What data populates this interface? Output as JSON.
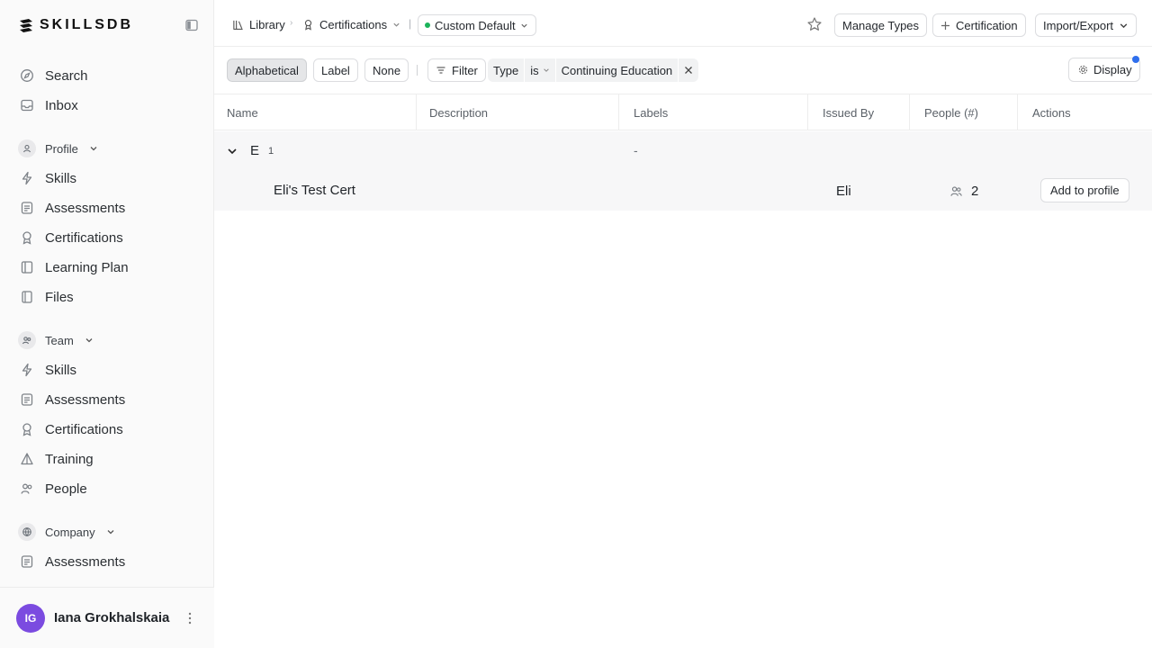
{
  "brand": {
    "name": "SKILLSDB"
  },
  "sidebar": {
    "top_items": [
      {
        "label": "Search",
        "icon": "compass-icon"
      },
      {
        "label": "Inbox",
        "icon": "inbox-icon"
      }
    ],
    "profile": {
      "label": "Profile",
      "items": [
        {
          "label": "Skills",
          "icon": "bolt-icon"
        },
        {
          "label": "Assessments",
          "icon": "clipboard-icon"
        },
        {
          "label": "Certifications",
          "icon": "award-icon"
        },
        {
          "label": "Learning Plan",
          "icon": "book-icon"
        },
        {
          "label": "Files",
          "icon": "file-icon"
        }
      ]
    },
    "team": {
      "label": "Team",
      "items": [
        {
          "label": "Skills",
          "icon": "bolt-icon"
        },
        {
          "label": "Assessments",
          "icon": "clipboard-icon"
        },
        {
          "label": "Certifications",
          "icon": "award-icon"
        },
        {
          "label": "Training",
          "icon": "training-icon"
        },
        {
          "label": "People",
          "icon": "people-icon"
        }
      ]
    },
    "company": {
      "label": "Company",
      "items": [
        {
          "label": "Assessments",
          "icon": "clipboard-icon"
        }
      ]
    },
    "user": {
      "initials": "IG",
      "name": "Iana Grokhalskaia",
      "avatar_color": "#7b4be0"
    }
  },
  "topbar": {
    "breadcrumb_library": "Library",
    "breadcrumb_certifications": "Certifications",
    "view_name": "Custom Default",
    "view_dot_color": "#1bb35a",
    "manage_types": "Manage Types",
    "add_certification": "Certification",
    "import_export": "Import/Export"
  },
  "filterbar": {
    "group_options": [
      "Alphabetical",
      "Label",
      "None"
    ],
    "filter_label": "Filter",
    "active_filter": {
      "field": "Type",
      "operator": "is",
      "value": "Continuing Education"
    },
    "display_label": "Display",
    "accent": "#2f6fed"
  },
  "table": {
    "columns": [
      "Name",
      "Description",
      "Labels",
      "Issued By",
      "People (#)",
      "Actions"
    ],
    "group": {
      "letter": "E",
      "count": "1",
      "labels_placeholder": "-"
    },
    "rows": [
      {
        "name": "Eli's Test Cert",
        "issued_by": "Eli",
        "people": "2",
        "action": "Add to profile"
      }
    ]
  }
}
